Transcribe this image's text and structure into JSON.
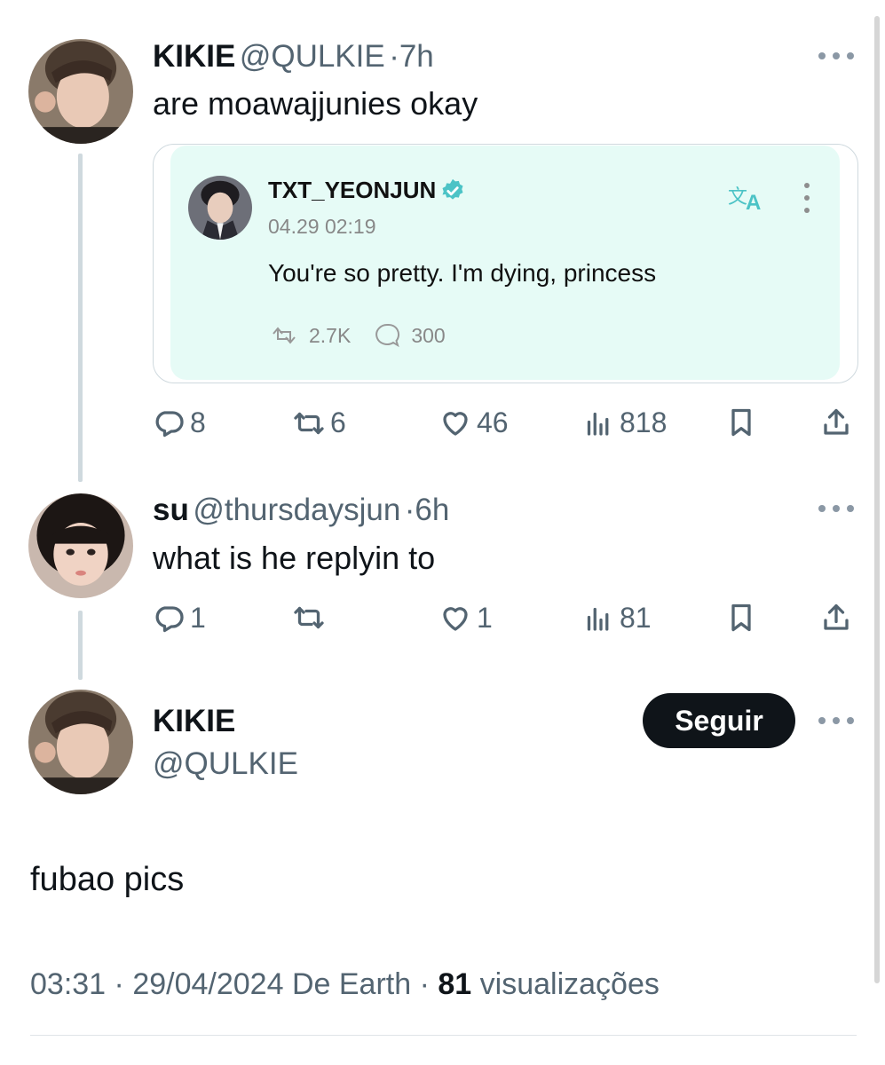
{
  "tweet1": {
    "name": "KIKIE",
    "handle": "@QULKIE",
    "time": "7h",
    "text": "are moawajjunies okay",
    "quote": {
      "name": "TXT_YEONJUN",
      "date": "04.29 02:19",
      "text": "You're so pretty. I'm dying, princess",
      "reposts": "2.7K",
      "comments": "300",
      "translate_icon": "translate-icon",
      "accent": "#4cc3c6"
    },
    "replies": "8",
    "retweets": "6",
    "likes": "46",
    "views": "818"
  },
  "tweet2": {
    "name": "su",
    "handle": "@thursdaysjun",
    "time": "6h",
    "text": "what is he replyin to",
    "replies": "1",
    "retweets": "",
    "likes": "1",
    "views": "81"
  },
  "main": {
    "name": "KIKIE",
    "handle": "@QULKIE",
    "follow_label": "Seguir",
    "text": "fubao pics",
    "time": "03:31",
    "date": "29/04/2024",
    "source": "De Earth",
    "views_count": "81",
    "views_label": "visualizações"
  },
  "colors": {
    "text": "#0f1419",
    "secondary": "#536471",
    "verified": "#4cc3c6",
    "quote_bg": "#e6fbf6"
  }
}
